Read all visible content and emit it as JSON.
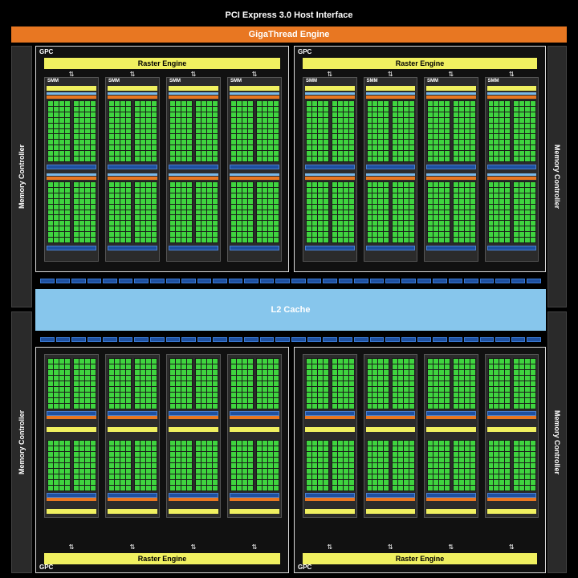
{
  "header": {
    "pcie_label": "PCI Express 3.0 Host Interface",
    "giga_label": "GigaThread Engine"
  },
  "memory_controllers": {
    "label": "Memory Controller"
  },
  "l2": {
    "label": "L2 Cache"
  },
  "gpcs": {
    "label": "GPC",
    "raster_label": "Raster Engine",
    "smm_label": "SMM"
  },
  "colors": {
    "background": "#000000",
    "giga": "#e87722",
    "l2": "#87c6ec",
    "raster": "#f0f060",
    "core": "#3fd43f",
    "crossbar": "#1e50a0"
  }
}
